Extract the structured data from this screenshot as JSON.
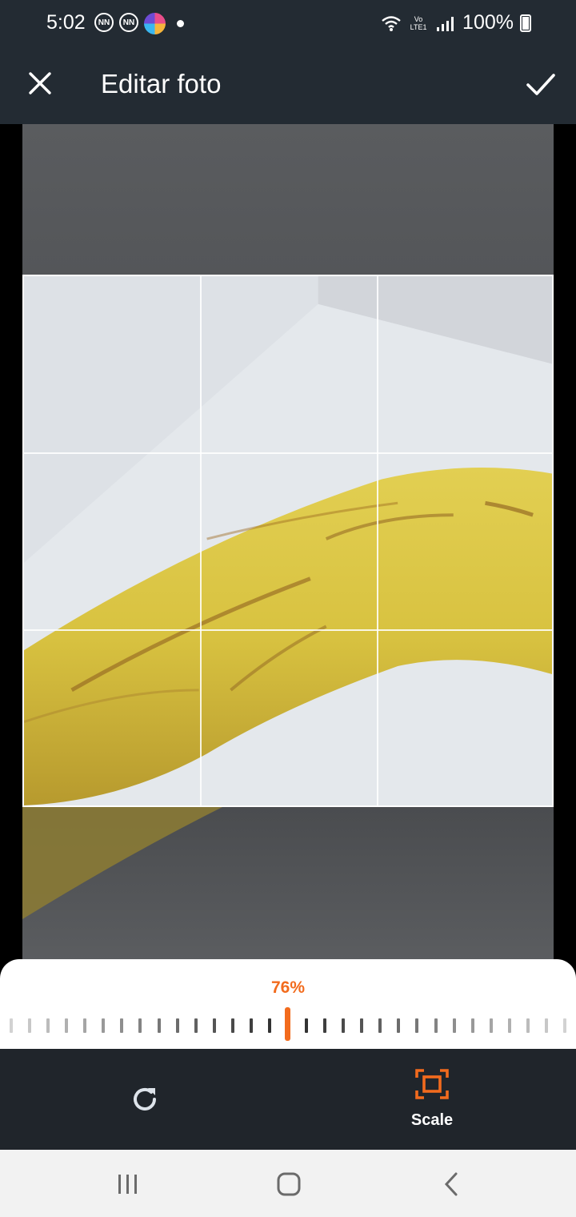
{
  "status_bar": {
    "time": "5:02",
    "notif_icons": [
      "NN",
      "NN"
    ],
    "signal_text": "Vo LTE1",
    "battery": "100%"
  },
  "app_bar": {
    "title": "Editar foto"
  },
  "zoom": {
    "label": "76%",
    "value_percent": 76
  },
  "toolbar": {
    "scale_label": "Scale",
    "accent": "#f26b1d"
  },
  "icons": [
    "close-icon",
    "check-icon",
    "rotate-icon",
    "scale-icon",
    "recent-apps-icon",
    "home-icon",
    "back-icon"
  ]
}
